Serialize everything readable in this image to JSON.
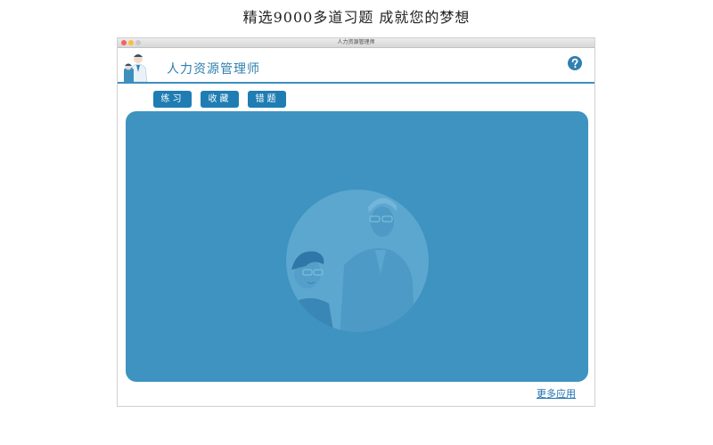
{
  "promo": {
    "headline": "精选9000多道习题   成就您的梦想"
  },
  "window": {
    "title": "人力资源管理师"
  },
  "app": {
    "title": "人力资源管理师",
    "help_icon": "question-circle-icon"
  },
  "tabs": [
    {
      "label": "练习"
    },
    {
      "label": "收藏"
    },
    {
      "label": "错题"
    }
  ],
  "footer": {
    "more_apps": "更多应用"
  },
  "colors": {
    "accent": "#1f7db3",
    "panel": "#3e93c0",
    "link": "#1e6fb0"
  }
}
